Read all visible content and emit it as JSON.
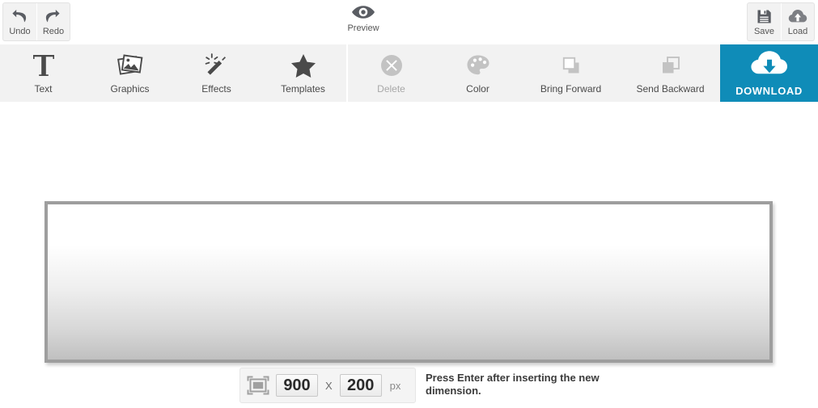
{
  "header": {
    "history": [
      {
        "label": "Undo",
        "icon": "undo-arrow-icon"
      },
      {
        "label": "Redo",
        "icon": "redo-arrow-icon"
      }
    ],
    "preview": {
      "label": "Preview",
      "icon": "eye-icon"
    },
    "file": [
      {
        "label": "Save",
        "icon": "floppy-disk-icon"
      },
      {
        "label": "Load",
        "icon": "cloud-upload-icon"
      }
    ]
  },
  "toolbar": {
    "enabled_tools": [
      {
        "label": "Text",
        "icon": "text-t-icon"
      },
      {
        "label": "Graphics",
        "icon": "photos-stack-icon"
      },
      {
        "label": "Effects",
        "icon": "magic-wand-icon"
      },
      {
        "label": "Templates",
        "icon": "star-icon"
      }
    ],
    "disabled_tools": [
      {
        "label": "Delete",
        "icon": "circle-x-icon"
      },
      {
        "label": "Color",
        "icon": "paint-palette-icon"
      },
      {
        "label": "Bring Forward",
        "icon": "bring-forward-icon"
      },
      {
        "label": "Send Backward",
        "icon": "send-backward-icon"
      }
    ],
    "download": {
      "label": "DOWNLOAD",
      "icon": "cloud-download-icon"
    }
  },
  "dimensions": {
    "icon": "resize-frame-icon",
    "width_value": "900",
    "height_value": "200",
    "separator": "X",
    "unit": "px",
    "hint": "Press Enter after inserting the new dimension."
  },
  "colors": {
    "accent": "#0f8cb8",
    "toolbar_bg": "#f2f2f2",
    "icon_enabled": "#4a4a4a",
    "icon_disabled": "#c3c3c3",
    "canvas_border": "#9e9e9e"
  }
}
